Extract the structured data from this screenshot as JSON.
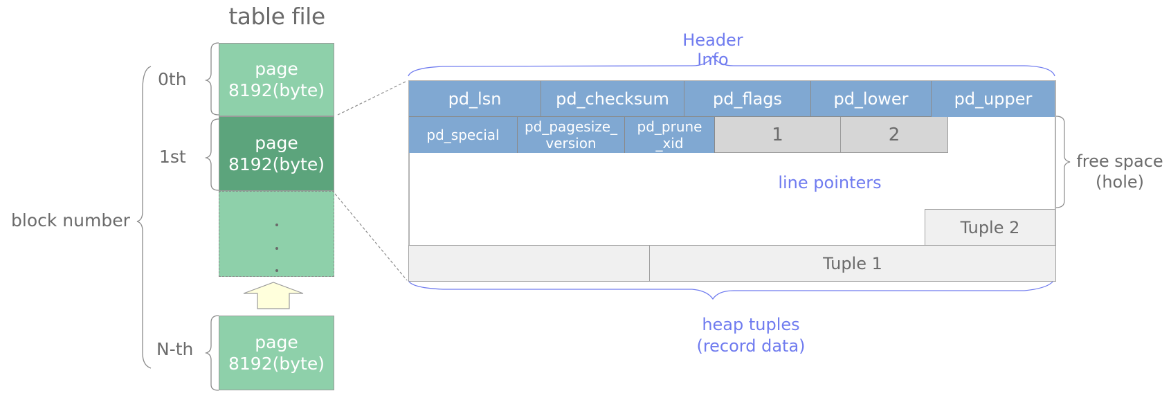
{
  "table_file": {
    "title": "table file",
    "pages": [
      {
        "line1": "page",
        "line2": "8192(byte)"
      },
      {
        "line1": "page",
        "line2": "8192(byte)"
      },
      {
        "line1": "page",
        "line2": "8192(byte)"
      }
    ],
    "block_labels": [
      "0th",
      "1st",
      "N-th"
    ],
    "block_number_label": "block number"
  },
  "page_layout": {
    "header_info_label": "Header Info",
    "header_row1": [
      "pd_lsn",
      "pd_checksum",
      "pd_flags",
      "pd_lower",
      "pd_upper"
    ],
    "header_row2": [
      {
        "line1": "pd_special",
        "line2": ""
      },
      {
        "line1": "pd_pagesize_",
        "line2": "version"
      },
      {
        "line1": "pd_prune",
        "line2": "_xid"
      }
    ],
    "line_pointers": [
      "1",
      "2"
    ],
    "line_pointers_label": "line pointers",
    "free_space_label_line1": "free space",
    "free_space_label_line2": "(hole)",
    "tuples": [
      "Tuple 2",
      "Tuple 1"
    ],
    "heap_tuples_label_line1": "heap tuples",
    "heap_tuples_label_line2": "(record data)"
  },
  "colors": {
    "page_light": "#8ed0aa",
    "page_dark": "#5ca47c",
    "header_blue": "#80a8d2",
    "line_pointer_gray": "#d6d6d6",
    "tuple_gray": "#f0f0f0",
    "label_blue": "#6f7bef",
    "label_gray": "#6b6b6b",
    "arrow_yellow": "#ffffdc"
  }
}
